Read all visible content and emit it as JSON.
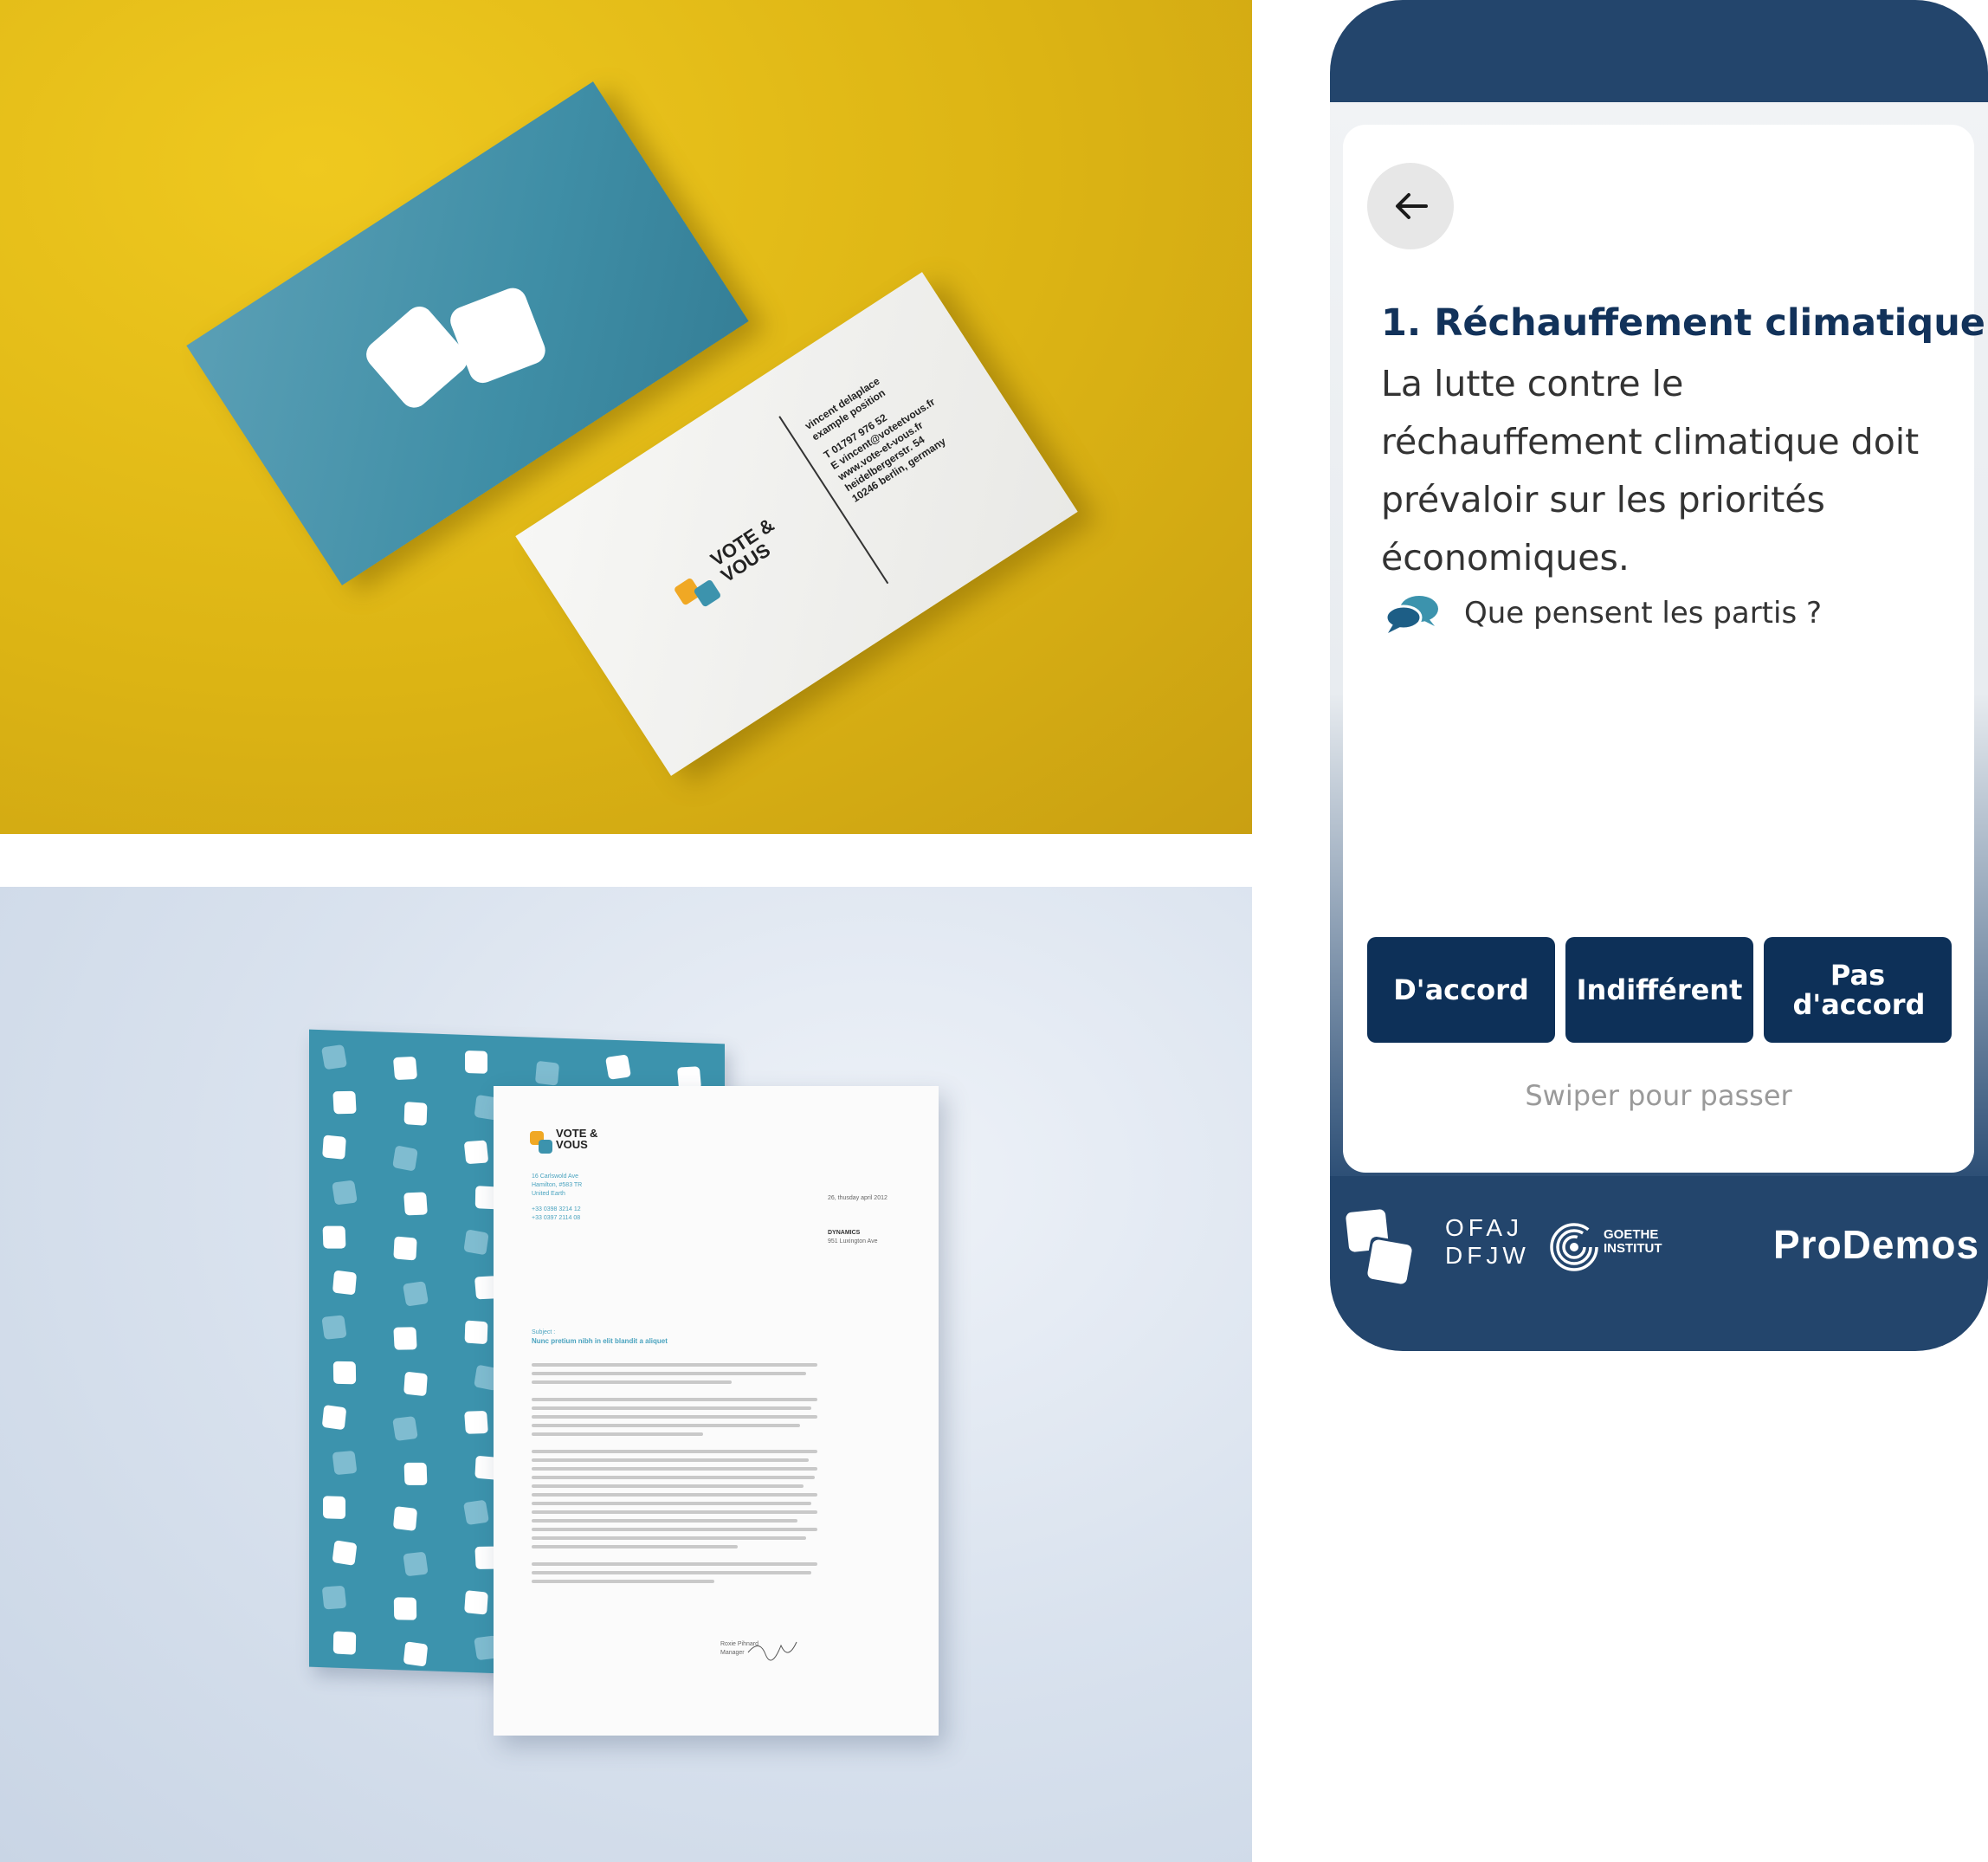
{
  "cards": {
    "brand_line1": "VOTE &",
    "brand_line2": "VOUS",
    "contact_name": "vincent delaplace",
    "contact_role": "example position",
    "contact_phone": "T 01797 976 52",
    "contact_email": "E vincent@voteetvous.fr",
    "contact_web": "www.vote-et-vous.fr",
    "contact_street": "heidelbergerstr. 54",
    "contact_city": "10246 berlin, germany"
  },
  "letter": {
    "brand_line1": "VOTE &",
    "brand_line2": "VOUS",
    "address_1": "16 Carlswold Ave",
    "address_2": "Hamilton, #583 TR",
    "address_3": "United Earth",
    "phone_1": "+33 0398 3214 12",
    "phone_2": "+33 0397 2114 08",
    "date": "26, thusday april 2012",
    "recipient_1": "DYNAMICS",
    "recipient_2": "951 Luxington Ave",
    "subject_label": "Subject :",
    "subject": "Nunc pretium nibh in elit blandit a aliquet",
    "signer_name": "Roxie Pihnard",
    "signer_role": "Manager"
  },
  "app": {
    "back_icon": "arrow-left-icon",
    "question_title": "1. Réchauffement climatique",
    "question_text": "La lutte contre le réchauffement climatique doit prévaloir sur les priorités économiques.",
    "parties_link": "Que pensent les partis ?",
    "parties_icon": "speech-bubbles-icon",
    "btn_agree": "D'accord",
    "btn_neutral": "Indifférent",
    "btn_disagree": "Pas d'accord",
    "swipe_hint": "Swiper pour passer",
    "footer": {
      "ofaj_line1": "OFAJ",
      "ofaj_line2": "DFJW",
      "goethe_line1": "GOETHE",
      "goethe_line2": "INSTITUT",
      "prodemos": "ProDemos"
    },
    "colors": {
      "navy": "#0d3058",
      "frame": "#23456c",
      "accent_orange": "#f0a824",
      "accent_teal": "#3c93ad"
    }
  }
}
